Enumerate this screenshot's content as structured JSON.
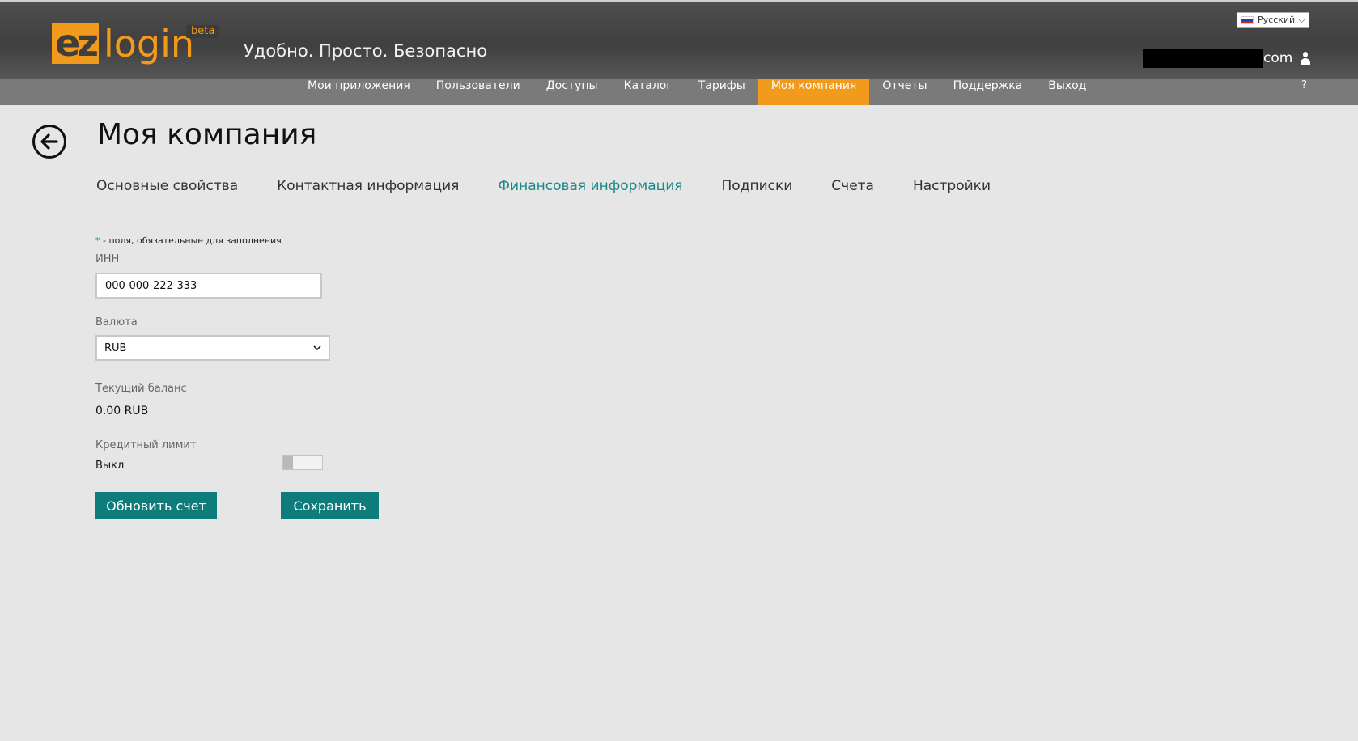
{
  "header": {
    "logo_ez": "ez",
    "logo_login": "login",
    "logo_beta": "beta",
    "slogan": "Удобно. Просто. Безопасно",
    "language": "Русский",
    "user_suffix": "com"
  },
  "nav": {
    "items": [
      {
        "label": "Мои приложения"
      },
      {
        "label": "Пользователи"
      },
      {
        "label": "Доступы"
      },
      {
        "label": "Каталог"
      },
      {
        "label": "Тарифы"
      },
      {
        "label": "Моя компания"
      },
      {
        "label": "Отчеты"
      },
      {
        "label": "Поддержка"
      },
      {
        "label": "Выход"
      }
    ],
    "active": "Моя компания",
    "help": "?"
  },
  "page": {
    "title": "Моя компания",
    "tabs": [
      {
        "label": "Основные свойства"
      },
      {
        "label": "Контактная информация"
      },
      {
        "label": "Финансовая информация"
      },
      {
        "label": "Подписки"
      },
      {
        "label": "Счета"
      },
      {
        "label": "Настройки"
      }
    ],
    "active_tab": "Финансовая информация"
  },
  "form": {
    "required_star": "*",
    "required_note": " - поля, обязательные для заполнения",
    "inn_label": "ИНН",
    "inn_value": "000-000-222-333",
    "currency_label": "Валюта",
    "currency_value": "RUB",
    "balance_label": "Текущий баланс",
    "balance_value": "0.00 RUB",
    "credit_label": "Кредитный лимит",
    "credit_state": "Выкл",
    "credit_enabled": false,
    "refresh_button": "Обновить счет",
    "save_button": "Сохранить"
  },
  "colors": {
    "accent_orange": "#f29a1c",
    "teal": "#0f7c7c",
    "active_tab": "#1a8a8a",
    "background": "#e6e6e6"
  }
}
